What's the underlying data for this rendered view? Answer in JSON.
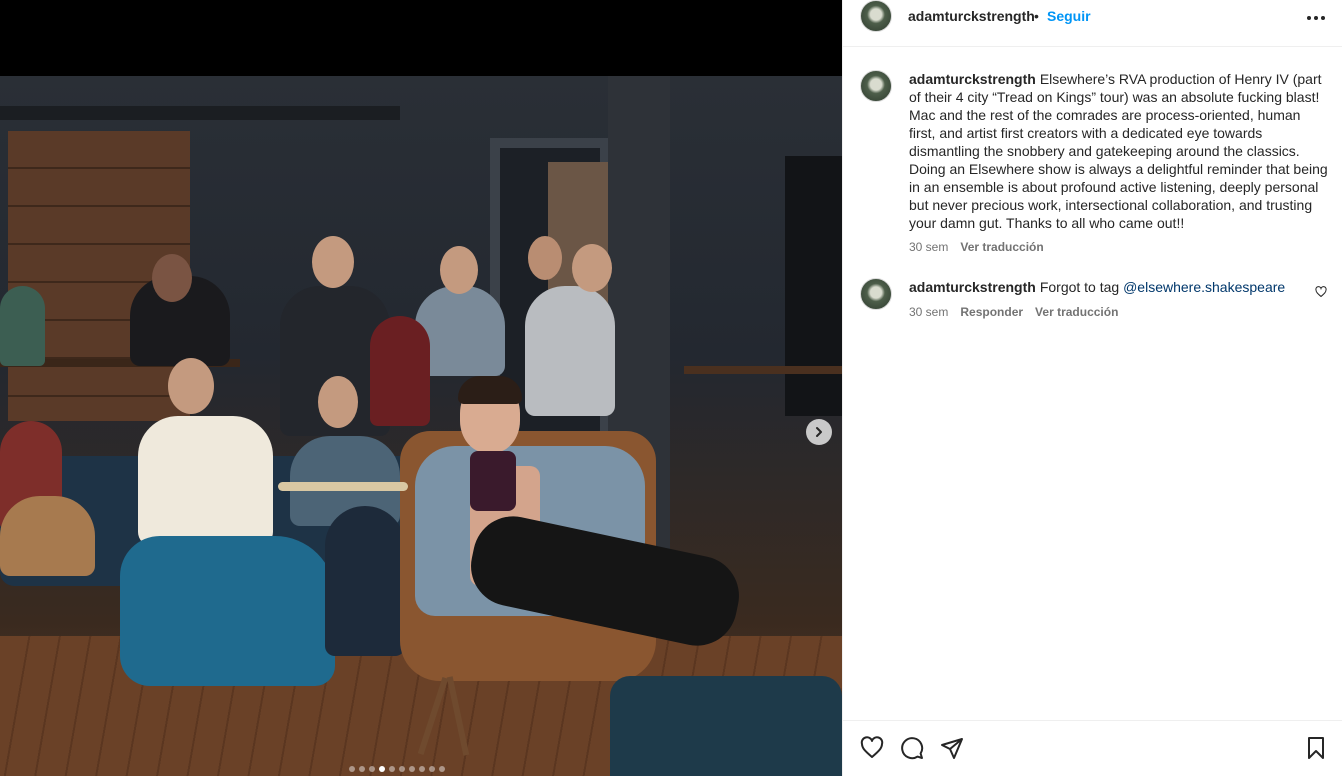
{
  "post": {
    "username": "adamturckstrength",
    "separator": "•",
    "follow_label": "Seguir",
    "more_label": "•••"
  },
  "caption": {
    "username": "adamturckstrength",
    "text": "Elsewhere’s RVA production of Henry IV (part of their 4 city “Tread on Kings” tour) was an absolute fucking blast! Mac and the rest of the comrades are process-oriented, human first, and artist first creators with a dedicated eye towards dismantling the snobbery and gatekeeping around the classics. Doing an Elsewhere show is always a delightful reminder that being in an ensemble is about profound active listening, deeply personal but never precious work, intersectional collaboration, and trusting your damn gut. Thanks to all who came out!!",
    "time": "30 sem",
    "translate_label": "Ver traducción"
  },
  "comments": [
    {
      "username": "adamturckstrength",
      "text": "Forgot to tag ",
      "mention": "@elsewhere.shakespeare",
      "time": "30 sem",
      "reply_label": "Responder",
      "translate_label": "Ver traducción"
    }
  ],
  "carousel": {
    "total": 10,
    "active_index": 3
  },
  "icons": [
    "more-icon",
    "chevron-right-icon",
    "heart-icon",
    "comment-icon",
    "share-icon",
    "bookmark-icon"
  ]
}
